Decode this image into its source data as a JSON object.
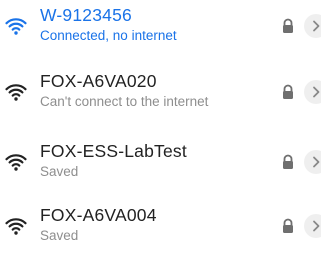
{
  "colors": {
    "accent": "#1a73e8",
    "primary_text": "#222222",
    "secondary_text": "#8e8e8e",
    "icon": "#222222",
    "lock_icon": "#6f6f6f",
    "detail_button_bg": "#efefef"
  },
  "networks": [
    {
      "ssid": "W-9123456",
      "status": "Connected, no internet",
      "connected": true,
      "secured": true,
      "icons": [
        "wifi-icon",
        "lock-icon",
        "chevron-right-icon"
      ]
    },
    {
      "ssid": "FOX-A6VA020",
      "status": "Can't connect to the internet",
      "connected": false,
      "secured": true,
      "icons": [
        "wifi-icon",
        "lock-icon",
        "chevron-right-icon"
      ]
    },
    {
      "ssid": "FOX-ESS-LabTest",
      "status": "Saved",
      "connected": false,
      "secured": true,
      "icons": [
        "wifi-icon",
        "lock-icon",
        "chevron-right-icon"
      ]
    },
    {
      "ssid": "FOX-A6VA004",
      "status": "Saved",
      "connected": false,
      "secured": true,
      "icons": [
        "wifi-icon",
        "lock-icon",
        "chevron-right-icon"
      ]
    }
  ]
}
